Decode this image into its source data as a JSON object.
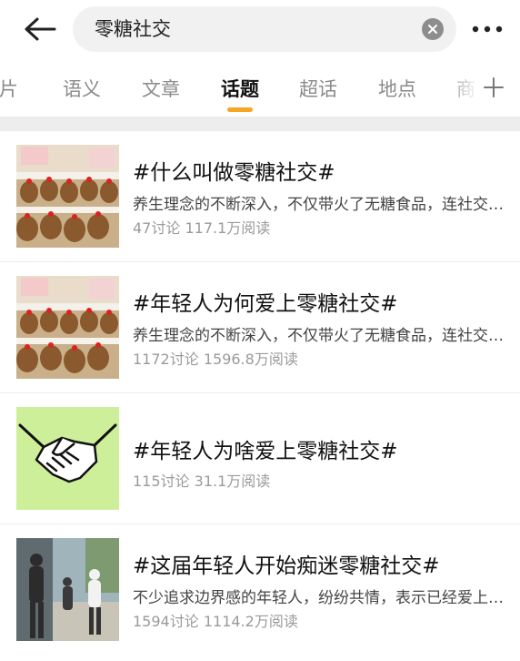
{
  "search": {
    "query": "零糖社交"
  },
  "tabs": [
    "图片",
    "语义",
    "文章",
    "话题",
    "超话",
    "地点",
    "商"
  ],
  "active_tab": "话题",
  "accent_color": "#f5a623",
  "topics": [
    {
      "title": "#什么叫做零糖社交#",
      "desc": "养生理念的不断深入，不仅带火了无糖食品，连社交也开始流行零糖了",
      "discussions": "47讨论",
      "reads": "117.1万阅读",
      "thumb_icon": "plush-toys-photo"
    },
    {
      "title": "#年轻人为何爱上零糖社交#",
      "desc": "养生理念的不断深入，不仅带火了无糖食品，连社交也开始流行零糖了",
      "discussions": "1172讨论",
      "reads": "1596.8万阅读",
      "thumb_icon": "plush-toys-photo"
    },
    {
      "title": "#年轻人为啥爱上零糖社交#",
      "discussions": "115讨论",
      "reads": "31.1万阅读",
      "thumb_icon": "handshake-icon"
    },
    {
      "title": "#这届年轻人开始痴迷零糖社交#",
      "desc": "不少追求边界感的年轻人，纷纷共情，表示已经爱上了零糖社交",
      "discussions": "1594讨论",
      "reads": "1114.2万阅读",
      "thumb_icon": "people-walking-photo"
    }
  ]
}
